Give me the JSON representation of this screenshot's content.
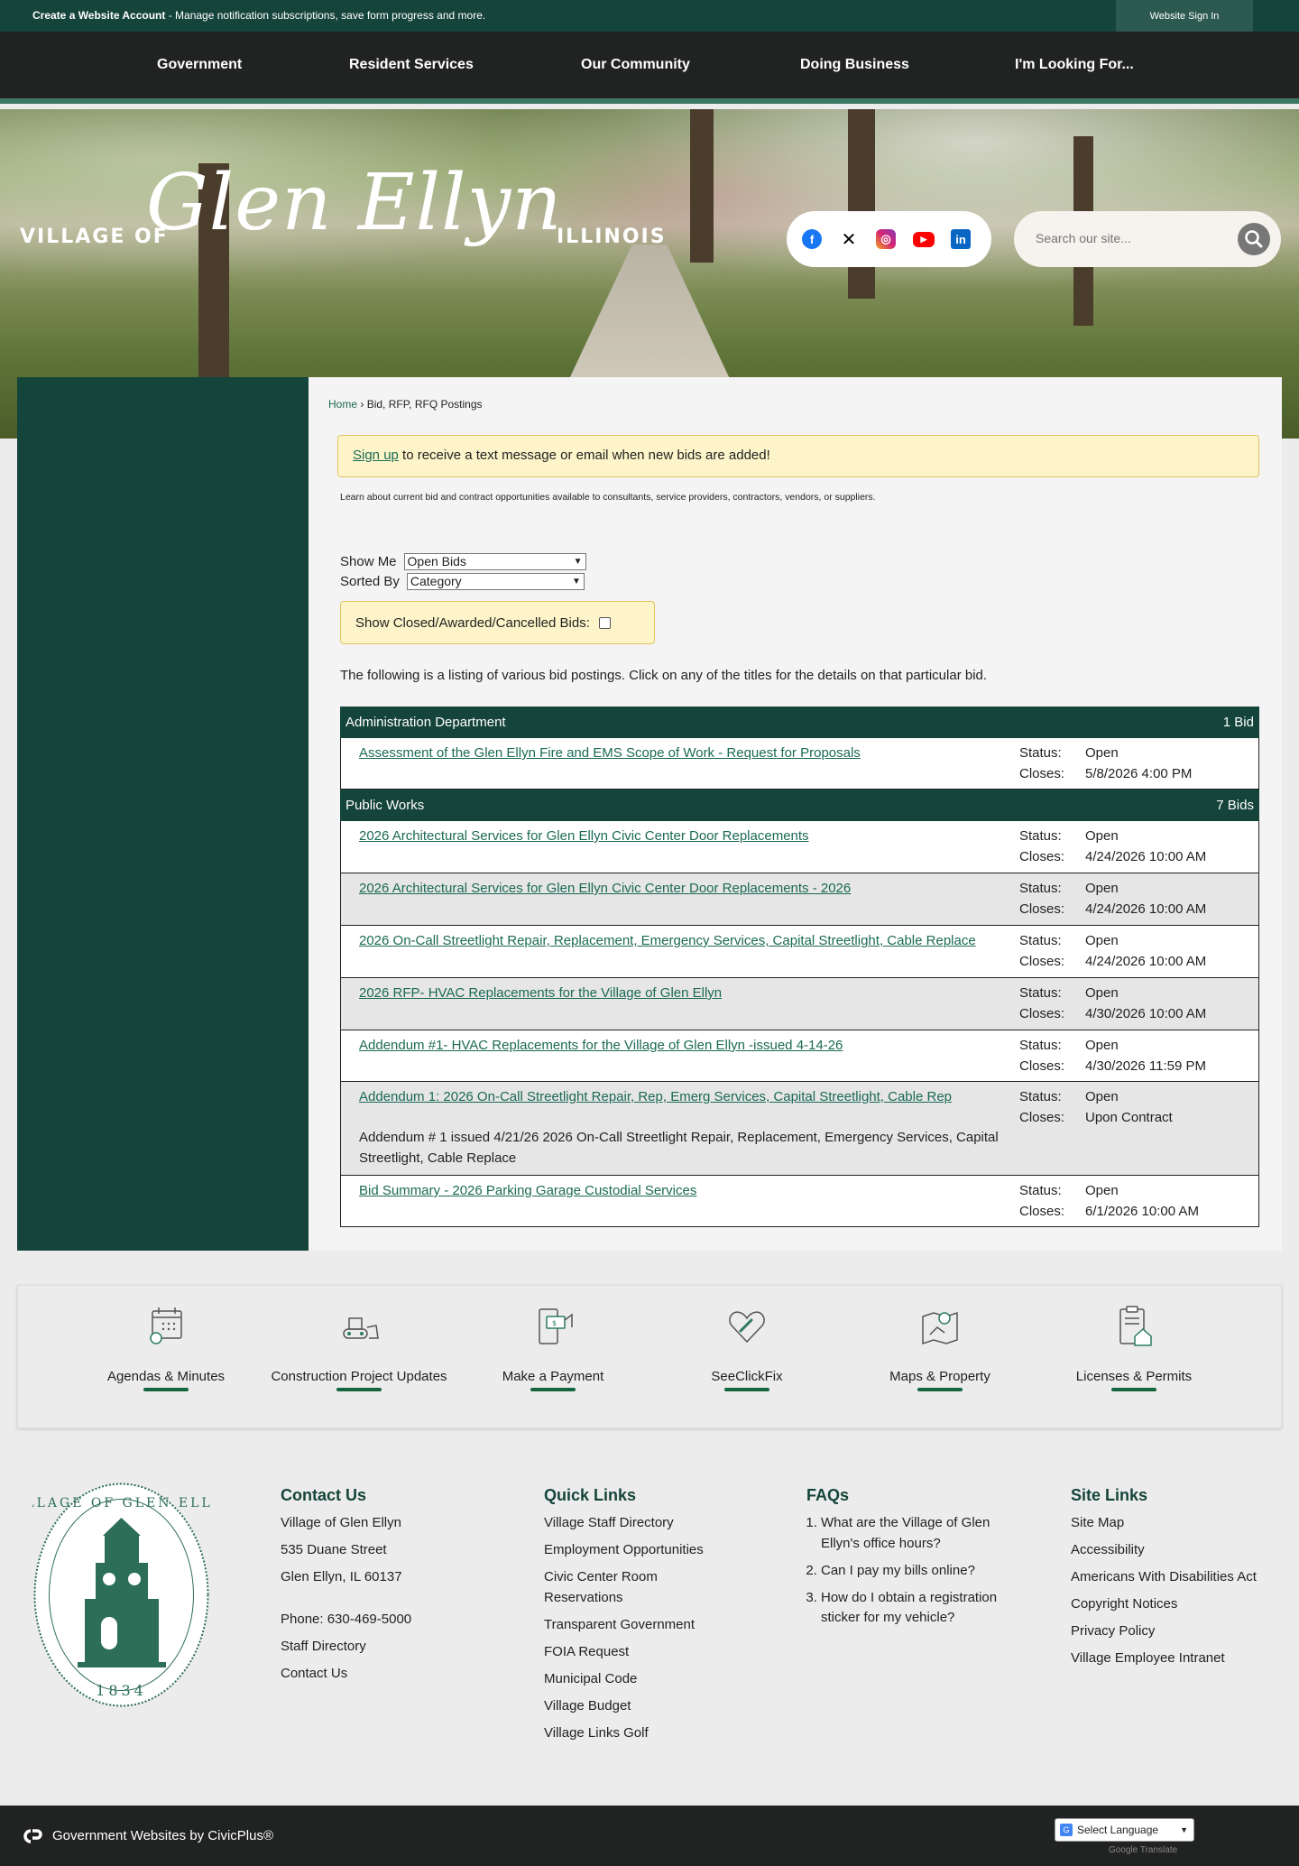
{
  "topbar": {
    "promo_bold": "Create a Website Account",
    "promo_text": " - Manage notification subscriptions, save form progress and more.",
    "signin": "Website Sign In"
  },
  "nav": [
    "Government",
    "Resident Services",
    "Our Community",
    "Doing Business",
    "I'm Looking For..."
  ],
  "logo": {
    "village": "VILLAGE OF",
    "name": "Glen Ellyn",
    "state": "ILLINOIS"
  },
  "social": {
    "facebook": "facebook-icon",
    "x": "x-icon",
    "instagram": "instagram-icon",
    "youtube": "youtube-icon",
    "linkedin": "linkedin-icon"
  },
  "search": {
    "placeholder": "Search our site..."
  },
  "breadcrumb": {
    "home": "Home",
    "sep": " › ",
    "current": "Bid, RFP, RFQ Postings"
  },
  "notice": {
    "link": "Sign up",
    "text": " to receive a text message or email when new bids are added!"
  },
  "intro": "Learn about current bid and contract opportunities available to consultants, service providers, contractors, vendors, or suppliers.",
  "filters": {
    "show_label": "Show Me",
    "show_value": "Open Bids",
    "sort_label": "Sorted By",
    "sort_value": "Category",
    "closed_label": "Show Closed/Awarded/Cancelled Bids:"
  },
  "listing_intro": "The following is a listing of various bid postings. Click on any of the titles for the details on that particular bid.",
  "labels": {
    "status": "Status:",
    "closes": "Closes:"
  },
  "categories": [
    {
      "name": "Administration Department",
      "count": "1 Bid",
      "bids": [
        {
          "title": "Assessment of the Glen Ellyn Fire and EMS Scope of Work - Request for Proposals",
          "status": "Open",
          "closes": "5/8/2026 4:00 PM"
        }
      ]
    },
    {
      "name": "Public Works",
      "count": "7 Bids",
      "bids": [
        {
          "title": "2026 Architectural Services for Glen Ellyn Civic Center Door Replacements",
          "status": "Open",
          "closes": "4/24/2026 10:00 AM"
        },
        {
          "title": "2026 Architectural Services for Glen Ellyn Civic Center Door Replacements - 2026",
          "status": "Open",
          "closes": "4/24/2026 10:00 AM"
        },
        {
          "title": "2026 On-Call Streetlight Repair, Replacement, Emergency Services, Capital Streetlight, Cable Replace",
          "status": "Open",
          "closes": "4/24/2026 10:00 AM"
        },
        {
          "title": "2026 RFP- HVAC Replacements for the Village of Glen Ellyn",
          "status": "Open",
          "closes": "4/30/2026 10:00 AM"
        },
        {
          "title": "Addendum #1- HVAC Replacements for the Village of Glen Ellyn -issued 4-14-26",
          "status": "Open",
          "closes": "4/30/2026 11:59 PM"
        },
        {
          "title": "Addendum 1: 2026 On-Call Streetlight Repair, Rep, Emerg Services, Capital Streetlight, Cable Rep",
          "desc": "Addendum # 1 issued 4/21/26 2026 On-Call Streetlight Repair, Replacement, Emergency Services, Capital Streetlight, Cable Replace",
          "status": "Open",
          "closes": "Upon Contract"
        },
        {
          "title": "Bid Summary - 2026 Parking Garage Custodial Services",
          "status": "Open",
          "closes": "6/1/2026 10:00 AM"
        }
      ]
    }
  ],
  "quicklinks": [
    {
      "label": "Agendas & Minutes",
      "icon": "calendar-icon"
    },
    {
      "label": "Construction Project Updates",
      "icon": "bulldozer-icon"
    },
    {
      "label": "Make a Payment",
      "icon": "payment-icon"
    },
    {
      "label": "SeeClickFix",
      "icon": "heart-wrench-icon"
    },
    {
      "label": "Maps & Property",
      "icon": "map-icon"
    },
    {
      "label": "Licenses & Permits",
      "icon": "clipboard-house-icon"
    }
  ],
  "seal": {
    "text": "VILLAGE OF GLEN ELLYN",
    "year": "1834"
  },
  "footer": {
    "contact": {
      "heading": "Contact Us",
      "lines": [
        "Village of Glen Ellyn",
        "535 Duane Street",
        "Glen Ellyn, IL 60137"
      ],
      "phone": "Phone: 630-469-5000",
      "links": [
        "Staff Directory",
        "Contact Us"
      ]
    },
    "quick": {
      "heading": "Quick Links",
      "links": [
        "Village Staff Directory",
        "Employment Opportunities",
        "Civic Center Room Reservations",
        "Transparent Government",
        "FOIA Request",
        "Municipal Code",
        "Village Budget",
        "Village Links Golf"
      ]
    },
    "faqs": {
      "heading": "FAQs",
      "items": [
        "What are the Village of Glen Ellyn's office hours?",
        "Can I pay my bills online?",
        "How do I obtain a registration sticker for my vehicle?"
      ]
    },
    "site": {
      "heading": "Site Links",
      "links": [
        "Site Map",
        "Accessibility",
        "Americans With Disabilities Act",
        "Copyright Notices",
        "Privacy Policy",
        "Village Employee Intranet"
      ]
    }
  },
  "bottom": {
    "civicplus": "Government Websites by CivicPlus®",
    "language": "Select Language",
    "translate": "Google Translate"
  },
  "colors": {
    "brand": "#15443a",
    "accent": "#1b6a54",
    "notice_bg": "#fdf5c9"
  }
}
